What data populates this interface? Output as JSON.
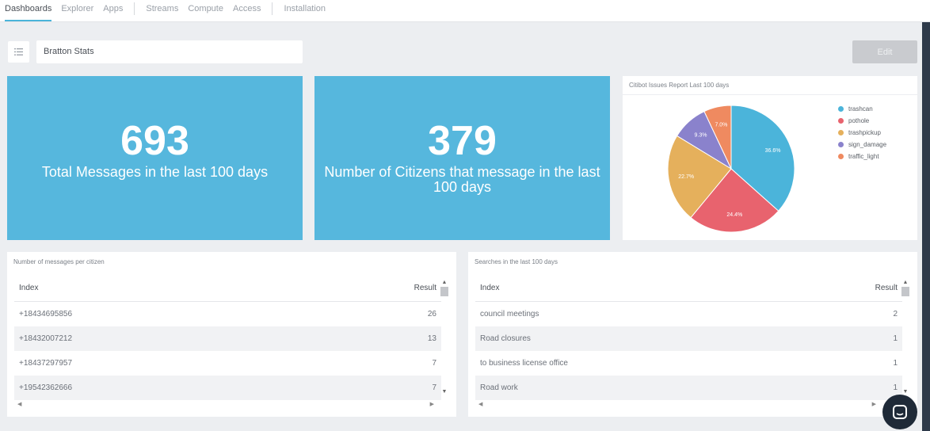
{
  "nav": {
    "tabs_group1": [
      "Dashboards",
      "Explorer",
      "Apps"
    ],
    "tabs_group2": [
      "Streams",
      "Compute",
      "Access"
    ],
    "tabs_group3": [
      "Installation"
    ]
  },
  "toolbar": {
    "dashboard_title": "Bratton Stats",
    "edit_label": "Edit"
  },
  "stats": [
    {
      "value": "693",
      "label": "Total Messages in the last 100 days"
    },
    {
      "value": "379",
      "label": "Number of Citizens that message in the last 100 days"
    }
  ],
  "pie": {
    "title": "Citibot Issues Report Last 100 days",
    "colors": {
      "trashcan": "#4bb4da",
      "pothole": "#e8636e",
      "trashpickup": "#e5b05c",
      "sign_damage": "#8a82cc",
      "traffic_light": "#ef8a60"
    }
  },
  "chart_data": {
    "type": "pie",
    "title": "Citibot Issues Report Last 100 days",
    "categories": [
      "trashcan",
      "pothole",
      "trashpickup",
      "sign_damage",
      "traffic_light"
    ],
    "values": [
      36.6,
      24.4,
      22.7,
      9.3,
      7.0
    ],
    "value_labels": [
      "36.6%",
      "24.4%",
      "22.7%",
      "9.3%",
      "7.0%"
    ],
    "legend": "right"
  },
  "messages_table": {
    "title": "Number of messages per citizen",
    "col_index": "Index",
    "col_result": "Result",
    "rows": [
      {
        "index": "+18434695856",
        "result": "26"
      },
      {
        "index": "+18432007212",
        "result": "13"
      },
      {
        "index": "+18437297957",
        "result": "7"
      },
      {
        "index": "+19542362666",
        "result": "7"
      }
    ]
  },
  "searches_table": {
    "title": "Searches in the last 100 days",
    "col_index": "Index",
    "col_result": "Result",
    "rows": [
      {
        "index": "council meetings",
        "result": "2"
      },
      {
        "index": "Road closures",
        "result": "1"
      },
      {
        "index": "to business license office",
        "result": "1"
      },
      {
        "index": "Road work",
        "result": "1"
      }
    ]
  },
  "icons": {
    "menu": "list-icon",
    "chat": "chat-icon",
    "scroll_up": "▲",
    "scroll_down": "▼",
    "scroll_left": "◀",
    "scroll_right": "▶"
  }
}
